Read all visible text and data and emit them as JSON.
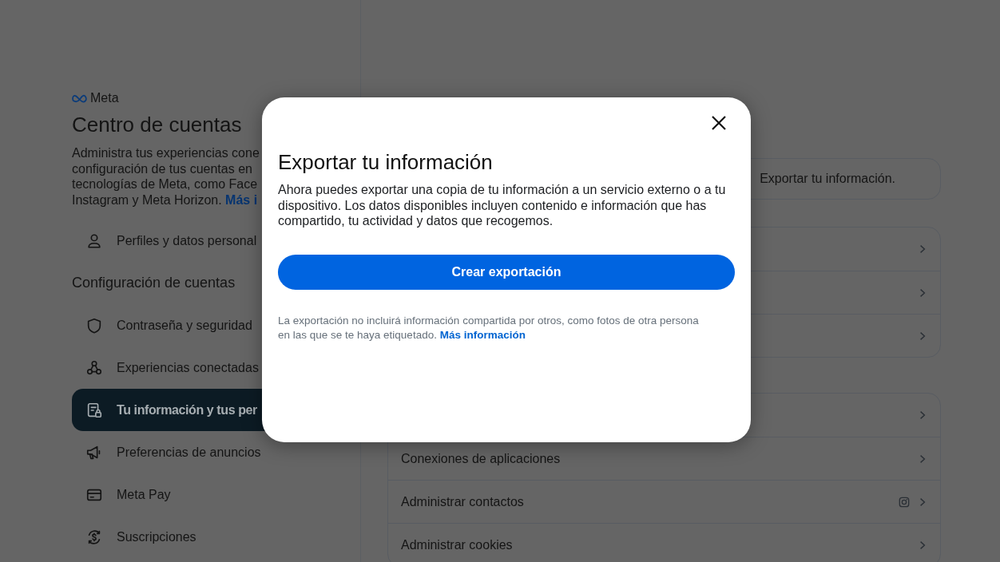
{
  "brand": {
    "name": "Meta"
  },
  "sidebar": {
    "title": "Centro de cuentas",
    "description": [
      "Administra tus experiencias cone",
      "configuración de tus cuentas en",
      "tecnologías de Meta, como Face",
      "Instagram y Meta Horizon."
    ],
    "description_link": "Más i",
    "items": [
      {
        "label": "Perfiles y datos personal",
        "selected": false
      }
    ],
    "section_heading": "Configuración de cuentas",
    "section_items": [
      {
        "label": "Contraseña y seguridad",
        "selected": false
      },
      {
        "label": "Experiencias conectadas",
        "selected": false
      },
      {
        "label": "Tu información y tus per",
        "selected": true
      },
      {
        "label": "Preferencias de anuncios",
        "selected": false
      },
      {
        "label": "Meta Pay",
        "selected": false
      },
      {
        "label": "Suscripciones",
        "selected": false
      }
    ]
  },
  "panel": {
    "notice": "Exportar tu información.",
    "groups": [
      {
        "rows": [
          {
            "kind": "plain"
          },
          {
            "kind": "plain"
          },
          {
            "kind": "plain"
          }
        ]
      },
      {
        "rows": [
          {
            "kind": "plain"
          },
          {
            "kind": "plain",
            "label": "Conexiones de aplicaciones"
          },
          {
            "kind": "app-icon",
            "label": "Administrar contactos"
          },
          {
            "kind": "plain",
            "label": "Administrar cookies"
          }
        ]
      }
    ]
  },
  "dialog": {
    "title": "Exportar tu información",
    "body": "Ahora puedes exportar una copia de tu información a un servicio externo o a tu dispositivo. Los datos disponibles incluyen contenido e información que has compartido, tu actividad y datos que recogemos.",
    "primary_button": "Crear exportación",
    "footnote": "La exportación no incluirá información compartida por otros, como fotos de otra persona en las que se te haya etiquetado.",
    "footnote_link": "Más información"
  }
}
